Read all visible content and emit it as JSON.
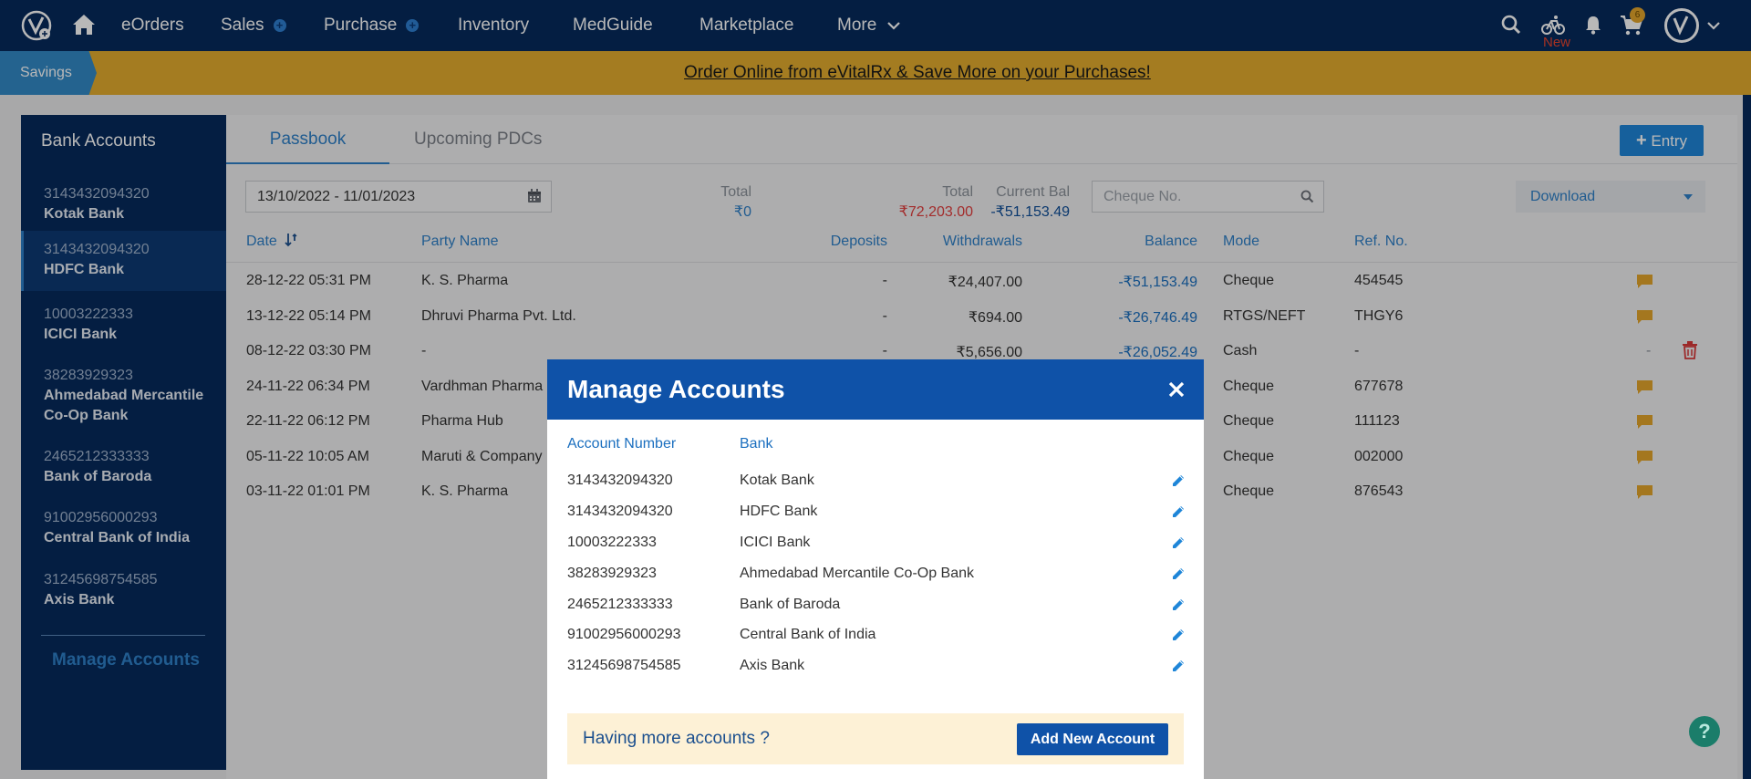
{
  "nav": {
    "items": [
      {
        "label": "eOrders"
      },
      {
        "label": "Sales"
      },
      {
        "label": "Purchase"
      },
      {
        "label": "Inventory"
      },
      {
        "label": "MedGuide"
      },
      {
        "label": "Marketplace"
      },
      {
        "label": "More"
      }
    ],
    "new_label": "New",
    "cart_count": "6",
    "icons": [
      "search-icon",
      "bike-icon",
      "bell-icon",
      "cart-icon",
      "avatar-icon"
    ]
  },
  "banner": {
    "savings": "Savings",
    "promo": "Order Online from eVitalRx & Save More on your Purchases!"
  },
  "sidebar": {
    "title": "Bank Accounts",
    "accounts": [
      {
        "number": "3143432094320",
        "bank": "Kotak Bank"
      },
      {
        "number": "3143432094320",
        "bank": "HDFC Bank"
      },
      {
        "number": "10003222333",
        "bank": "ICICI Bank"
      },
      {
        "number": "38283929323",
        "bank": "Ahmedabad Mercantile Co-Op Bank"
      },
      {
        "number": "2465212333333",
        "bank": "Bank of Baroda"
      },
      {
        "number": "91002956000293",
        "bank": "Central Bank of India"
      },
      {
        "number": "31245698754585",
        "bank": "Axis Bank"
      }
    ],
    "active_index": 1,
    "manage": "Manage Accounts"
  },
  "main": {
    "tabs": [
      {
        "label": "Passbook"
      },
      {
        "label": "Upcoming PDCs"
      }
    ],
    "entry_label": "Entry",
    "date_range": "13/10/2022 - 11/01/2023",
    "stats": [
      {
        "label": "Total",
        "value": "₹0",
        "color": "#2f80c8"
      },
      {
        "label": "Total",
        "value": "₹72,203.00",
        "color": "#e23d3d"
      },
      {
        "label": "Current Bal",
        "value": "-₹51,153.49",
        "color": "#0f4e99"
      }
    ],
    "cheque_placeholder": "Cheque No.",
    "download_label": "Download",
    "columns": [
      "Date",
      "Party Name",
      "Deposits",
      "Withdrawals",
      "Balance",
      "Mode",
      "Ref. No."
    ],
    "rows": [
      {
        "date": "28-12-22 05:31 PM",
        "party": "K. S. Pharma",
        "deposits": "-",
        "withdrawals": "₹24,407.00",
        "balance": "-₹51,153.49",
        "mode": "Cheque",
        "ref": "454545"
      },
      {
        "date": "13-12-22 05:14 PM",
        "party": "Dhruvi Pharma Pvt. Ltd.",
        "deposits": "-",
        "withdrawals": "₹694.00",
        "balance": "-₹26,746.49",
        "mode": "RTGS/NEFT",
        "ref": "THGY6"
      },
      {
        "date": "08-12-22 03:30 PM",
        "party": "-",
        "deposits": "-",
        "withdrawals": "₹5,656.00",
        "balance": "-₹26,052.49",
        "mode": "Cash",
        "ref": "-"
      },
      {
        "date": "24-11-22 06:34 PM",
        "party": "Vardhman Pharma",
        "deposits": "",
        "withdrawals": "",
        "balance": "",
        "mode": "Cheque",
        "ref": "677678"
      },
      {
        "date": "22-11-22 06:12 PM",
        "party": "Pharma Hub",
        "deposits": "",
        "withdrawals": "",
        "balance": "",
        "mode": "Cheque",
        "ref": "111123"
      },
      {
        "date": "05-11-22 10:05 AM",
        "party": "Maruti & Company",
        "deposits": "",
        "withdrawals": "",
        "balance": "",
        "mode": "Cheque",
        "ref": "002000"
      },
      {
        "date": "03-11-22 01:01 PM",
        "party": "K. S. Pharma",
        "deposits": "",
        "withdrawals": "",
        "balance": "",
        "mode": "Cheque",
        "ref": "876543"
      }
    ],
    "row3_extra": "-"
  },
  "modal": {
    "title": "Manage Accounts",
    "col_account": "Account Number",
    "col_bank": "Bank",
    "rows": [
      {
        "number": "3143432094320",
        "bank": "Kotak Bank"
      },
      {
        "number": "3143432094320",
        "bank": "HDFC Bank"
      },
      {
        "number": "10003222333",
        "bank": "ICICI Bank"
      },
      {
        "number": "38283929323",
        "bank": "Ahmedabad Mercantile Co-Op Bank"
      },
      {
        "number": "2465212333333",
        "bank": "Bank of Baroda"
      },
      {
        "number": "91002956000293",
        "bank": "Central Bank of India"
      },
      {
        "number": "31245698754585",
        "bank": "Axis Bank"
      }
    ],
    "more_text": "Having more accounts ?",
    "add_label": "Add New Account"
  },
  "help": "?"
}
